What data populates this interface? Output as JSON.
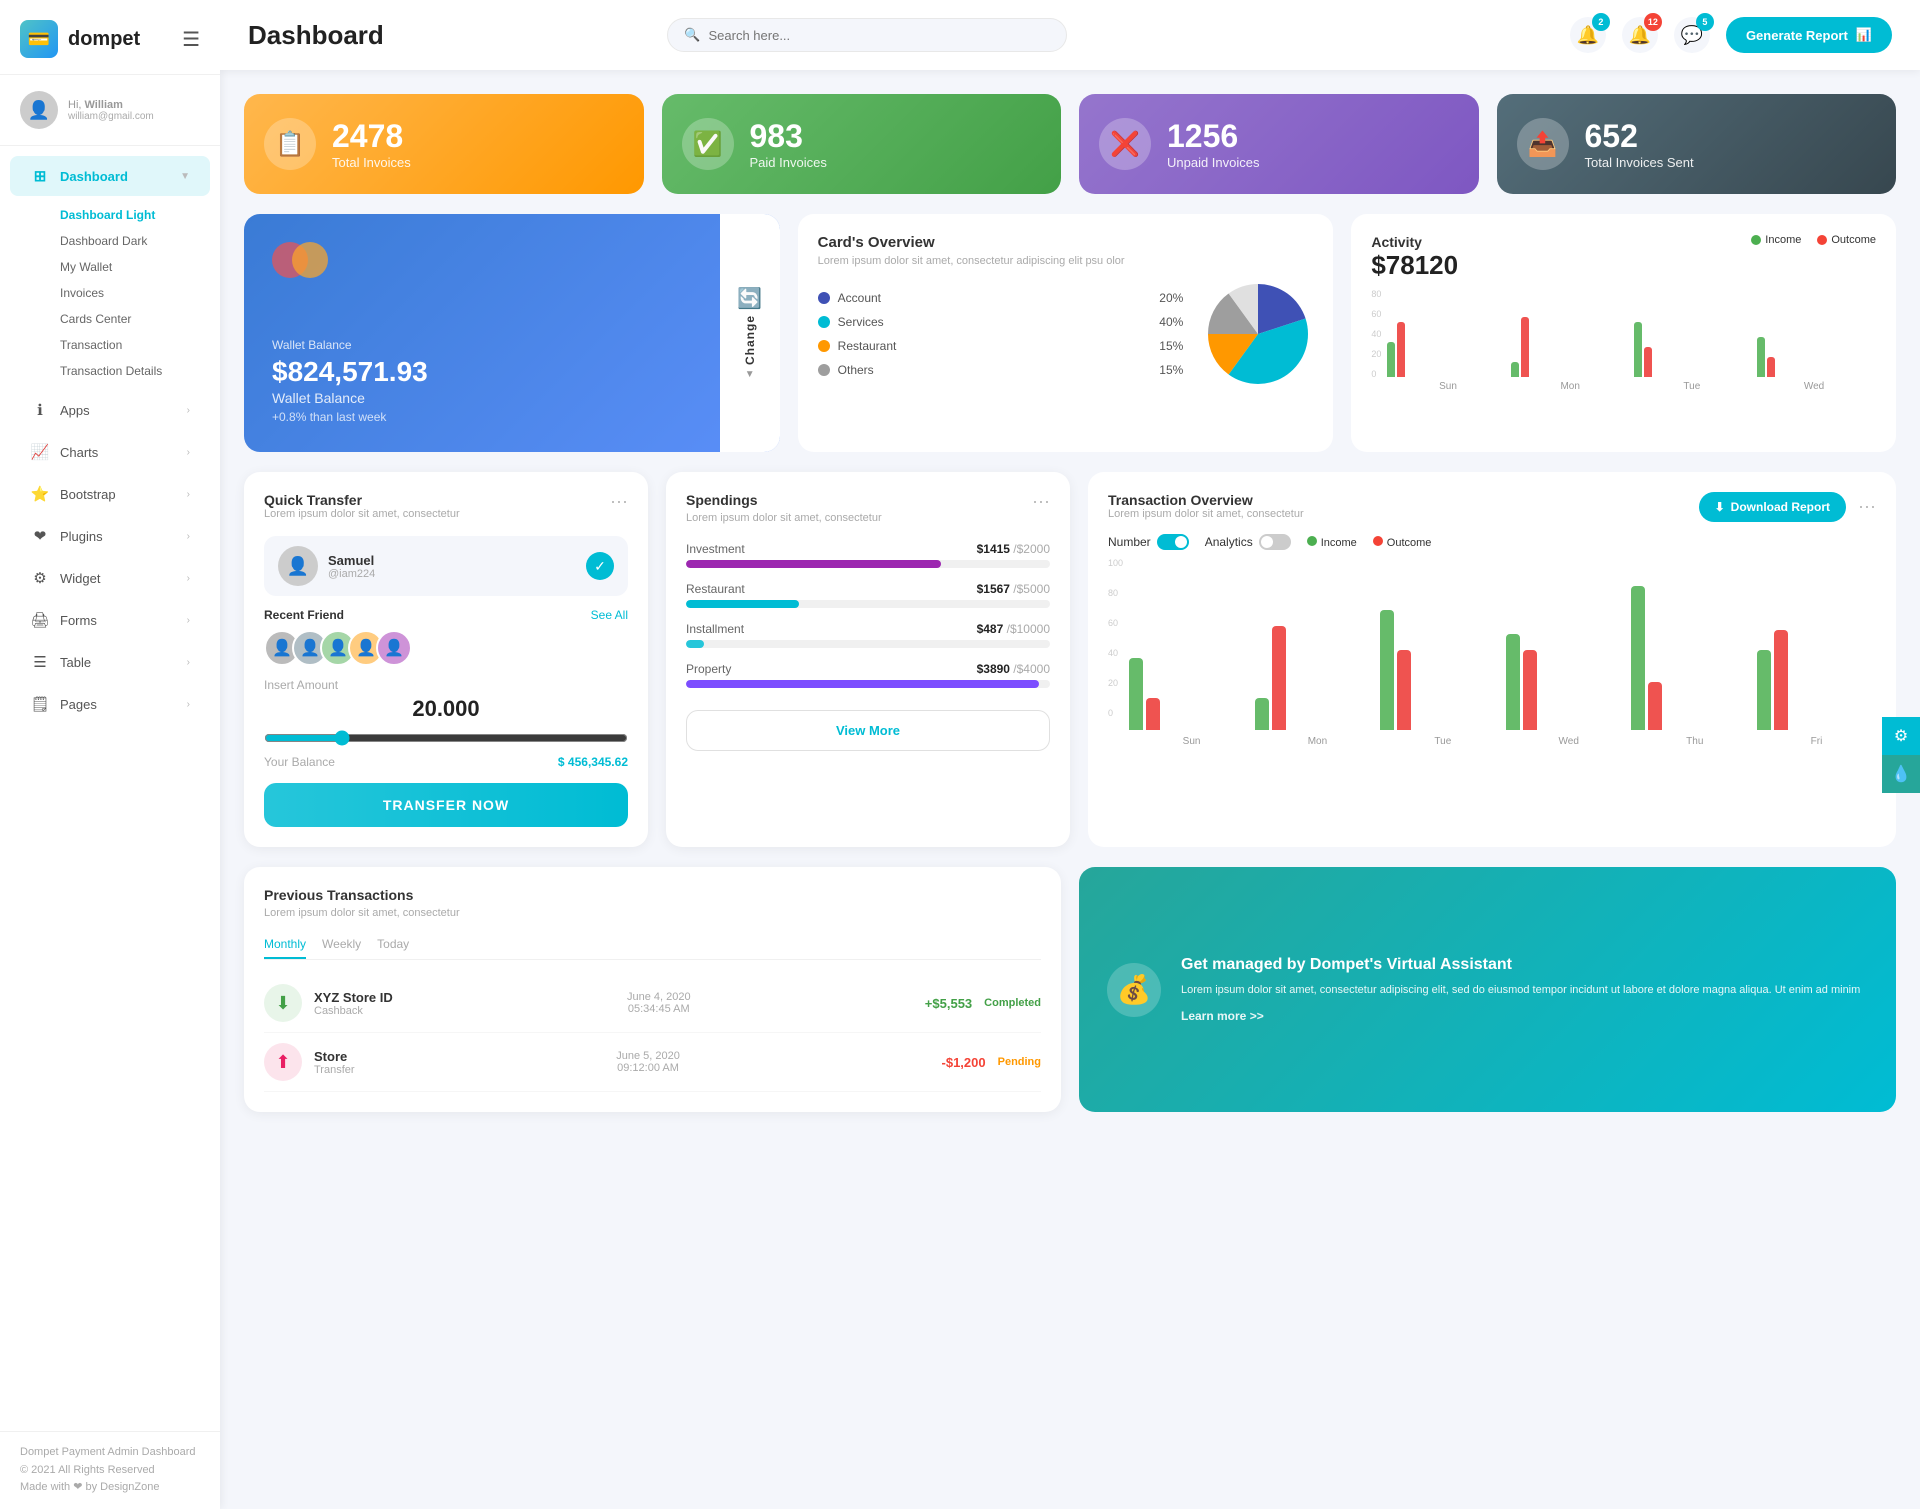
{
  "app": {
    "logo_text": "dompet",
    "logo_icon": "💳"
  },
  "topbar": {
    "title": "Dashboard",
    "search_placeholder": "Search here...",
    "generate_btn": "Generate Report",
    "notifications_count": "2",
    "bell_count": "12",
    "message_count": "5"
  },
  "sidebar": {
    "user_greeting": "Hi,",
    "user_name": "William",
    "user_email": "william@gmail.com",
    "nav_items": [
      {
        "label": "Dashboard",
        "icon": "⊞",
        "active": true,
        "has_arrow": true
      },
      {
        "label": "Apps",
        "icon": "ℹ",
        "active": false,
        "has_arrow": true
      },
      {
        "label": "Charts",
        "icon": "📈",
        "active": false,
        "has_arrow": true
      },
      {
        "label": "Bootstrap",
        "icon": "⭐",
        "active": false,
        "has_arrow": true
      },
      {
        "label": "Plugins",
        "icon": "❤",
        "active": false,
        "has_arrow": true
      },
      {
        "label": "Widget",
        "icon": "⚙",
        "active": false,
        "has_arrow": true
      },
      {
        "label": "Forms",
        "icon": "🖨",
        "active": false,
        "has_arrow": true
      },
      {
        "label": "Table",
        "icon": "☰",
        "active": false,
        "has_arrow": true
      },
      {
        "label": "Pages",
        "icon": "🗒",
        "active": false,
        "has_arrow": true
      }
    ],
    "sub_items": [
      {
        "label": "Dashboard Light",
        "active": true
      },
      {
        "label": "Dashboard Dark",
        "active": false
      },
      {
        "label": "My Wallet",
        "active": false
      },
      {
        "label": "Invoices",
        "active": false
      },
      {
        "label": "Cards Center",
        "active": false
      },
      {
        "label": "Transaction",
        "active": false
      },
      {
        "label": "Transaction Details",
        "active": false
      }
    ],
    "footer_line1": "Dompet Payment Admin Dashboard",
    "footer_line2": "© 2021 All Rights Reserved",
    "footer_line3": "Made with ❤ by DesignZone"
  },
  "stat_cards": [
    {
      "number": "2478",
      "label": "Total Invoices",
      "color": "orange",
      "icon": "📋"
    },
    {
      "number": "983",
      "label": "Paid Invoices",
      "color": "green",
      "icon": "✅"
    },
    {
      "number": "1256",
      "label": "Unpaid Invoices",
      "color": "purple",
      "icon": "❌"
    },
    {
      "number": "652",
      "label": "Total Invoices Sent",
      "color": "blue-gray",
      "icon": "📤"
    }
  ],
  "wallet": {
    "balance": "$824,571.93",
    "label": "Wallet Balance",
    "name": "Wallet Balance",
    "change_text": "+0.8% than last week",
    "change_btn_label": "Change"
  },
  "cards_overview": {
    "title": "Card's Overview",
    "subtitle": "Lorem ipsum dolor sit amet, consectetur adipiscing elit psu olor",
    "legend": [
      {
        "label": "Account",
        "value": "20%",
        "color": "#3f51b5"
      },
      {
        "label": "Services",
        "value": "40%",
        "color": "#00bcd4"
      },
      {
        "label": "Restaurant",
        "value": "15%",
        "color": "#ff9800"
      },
      {
        "label": "Others",
        "value": "15%",
        "color": "#9e9e9e"
      }
    ]
  },
  "activity": {
    "title": "Activity",
    "amount": "$78120",
    "legend_income": "Income",
    "legend_outcome": "Outcome",
    "bars": [
      {
        "day": "Sun",
        "income": 35,
        "outcome": 55
      },
      {
        "day": "Mon",
        "income": 15,
        "outcome": 60
      },
      {
        "day": "Tue",
        "income": 55,
        "outcome": 30
      },
      {
        "day": "Wed",
        "income": 40,
        "outcome": 20
      }
    ],
    "y_labels": [
      "80",
      "60",
      "40",
      "20",
      "0"
    ]
  },
  "quick_transfer": {
    "title": "Quick Transfer",
    "subtitle": "Lorem ipsum dolor sit amet, consectetur",
    "contact_name": "Samuel",
    "contact_handle": "@iam224",
    "recent_friends_label": "Recent Friend",
    "see_all": "See All",
    "insert_amount_label": "Insert Amount",
    "amount": "20.000",
    "balance_label": "Your Balance",
    "balance": "$ 456,345.62",
    "transfer_btn": "TRANSFER NOW"
  },
  "spendings": {
    "title": "Spendings",
    "subtitle": "Lorem ipsum dolor sit amet, consectetur",
    "items": [
      {
        "label": "Investment",
        "amount": "$1415",
        "total": "/$2000",
        "color": "#9c27b0",
        "pct": 70
      },
      {
        "label": "Restaurant",
        "amount": "$1567",
        "total": "/$5000",
        "color": "#00bcd4",
        "pct": 31
      },
      {
        "label": "Installment",
        "amount": "$487",
        "total": "/$10000",
        "color": "#26c6da",
        "pct": 5
      },
      {
        "label": "Property",
        "amount": "$3890",
        "total": "/$4000",
        "color": "#7c4dff",
        "pct": 97
      }
    ],
    "view_more_btn": "View More"
  },
  "transaction_overview": {
    "title": "Transaction Overview",
    "subtitle": "Lorem ipsum dolor sit amet, consectetur",
    "number_toggle": "Number",
    "analytics_toggle": "Analytics",
    "download_btn": "Download Report",
    "legend_income": "Income",
    "legend_outcome": "Outcome",
    "bars": [
      {
        "day": "Sun",
        "income": 45,
        "outcome": 20
      },
      {
        "day": "Mon",
        "income": 20,
        "outcome": 65
      },
      {
        "day": "Tue",
        "income": 75,
        "outcome": 50
      },
      {
        "day": "Wed",
        "income": 60,
        "outcome": 50
      },
      {
        "day": "Thu",
        "income": 90,
        "outcome": 30
      },
      {
        "day": "Fri",
        "income": 50,
        "outcome": 62
      }
    ]
  },
  "previous_transactions": {
    "title": "Previous Transactions",
    "subtitle": "Lorem ipsum dolor sit amet, consectetur",
    "tabs": [
      "Monthly",
      "Weekly",
      "Today"
    ],
    "active_tab": "Monthly",
    "items": [
      {
        "name": "XYZ Store ID",
        "sub": "Cashback",
        "date": "June 4, 2020",
        "time": "05:34:45 AM",
        "amount": "+$5,553",
        "status": "Completed",
        "icon": "⬇",
        "icon_style": "green"
      },
      {
        "name": "Store",
        "sub": "Transfer",
        "date": "June 5, 2020",
        "time": "09:12:00 AM",
        "amount": "-$1,200",
        "status": "Pending",
        "icon": "⬆",
        "icon_style": "pink"
      }
    ]
  },
  "virtual_assistant": {
    "title": "Get managed by Dompet's Virtual Assistant",
    "body": "Lorem ipsum dolor sit amet, consectetur adipiscing elit, sed do eiusmod tempor incidunt ut labore et dolore magna aliqua. Ut enim ad minim",
    "link_text": "Learn more >>",
    "icon": "💰"
  }
}
